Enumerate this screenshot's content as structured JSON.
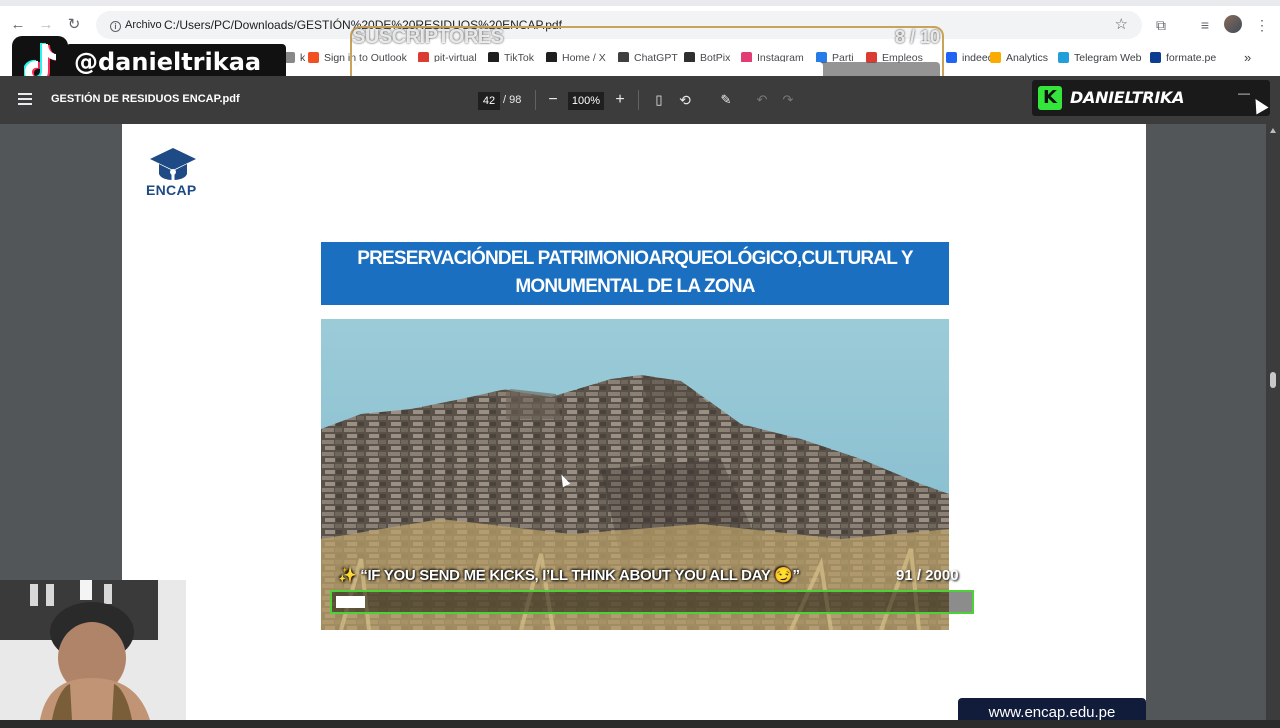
{
  "browser": {
    "site_chip": "Archivo",
    "url": "C:/Users/PC/Downloads/GESTIÓN%20DE%20RESIDUOS%20ENCAP.pdf"
  },
  "bookmarks": [
    {
      "label": "k",
      "color": "#888888"
    },
    {
      "label": "Sign in to Outlook",
      "color": "#f25022"
    },
    {
      "label": "pit-virtual",
      "color": "#d93025"
    },
    {
      "label": "TikTok",
      "color": "#111111"
    },
    {
      "label": "Home / X",
      "color": "#111111"
    },
    {
      "label": "ChatGPT",
      "color": "#333333"
    },
    {
      "label": "BotPix",
      "color": "#222222"
    },
    {
      "label": "Instagram",
      "color": "#e1306c"
    },
    {
      "label": "Parti",
      "color": "#1a73e8"
    },
    {
      "label": "Empleos",
      "color": "#d93025"
    },
    {
      "label": "indeed",
      "color": "#2164f3"
    },
    {
      "label": "Analytics",
      "color": "#f9ab00"
    },
    {
      "label": "Telegram Web",
      "color": "#229ed9"
    },
    {
      "label": "formate.pe",
      "color": "#0b3d91"
    }
  ],
  "overlays": {
    "tiktok_handle": "@danieltrikaa",
    "subs_label": "SUSCRIPTORES",
    "subs_count": "8  / 10",
    "subs_progress": 0.8,
    "streamer_name": "DANIELTRIKA",
    "streamer_logo_letter": "K",
    "name_minimize": "—",
    "kicks_text": "✨ “IF YOU SEND ME KICKS, I’LL THINK ABOUT YOU ALL DAY 😏”",
    "kicks_count": "91  / 2000",
    "kicks_progress": 0.0455
  },
  "pdf": {
    "title": "GESTIÓN DE RESIDUOS ENCAP.pdf",
    "page_current": "42",
    "page_total": "/ 98",
    "zoom": "100%"
  },
  "slide": {
    "logo_text": "ENCAP",
    "heading": "PRESERVACIÓNDEL PATRIMONIOARQUEOLÓGICO,CULTURAL Y MONUMENTAL DE LA  ZONA",
    "footer_url": "www.encap.edu.pe"
  },
  "colors": {
    "slide_header": "#1a6fc0",
    "pdf_toolbar": "#3c3c3c",
    "kicks_border": "#4cd137",
    "subs_border": "#c9a35a",
    "kick_green": "#34e63c"
  }
}
